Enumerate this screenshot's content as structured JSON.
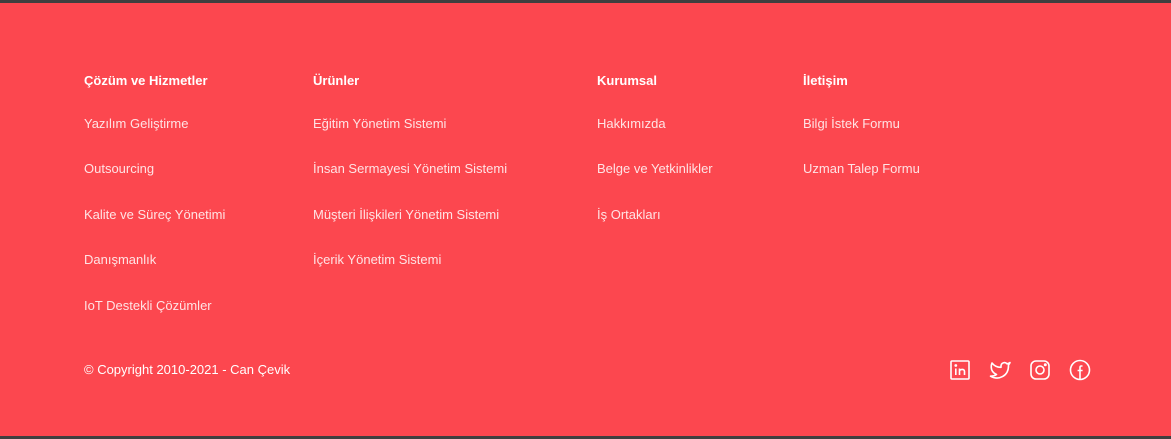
{
  "footer": {
    "columns": [
      {
        "title": "Çözüm ve Hizmetler",
        "items": [
          "Yazılım Geliştirme",
          "Outsourcing",
          "Kalite ve Süreç Yönetimi",
          "Danışmanlık",
          "IoT Destekli Çözümler"
        ]
      },
      {
        "title": "Ürünler",
        "items": [
          "Eğitim Yönetim Sistemi",
          "İnsan Sermayesi Yönetim Sistemi",
          "Müşteri İlişkileri Yönetim Sistemi",
          "İçerik Yönetim Sistemi"
        ]
      },
      {
        "title": "Kurumsal",
        "items": [
          "Hakkımızda",
          "Belge ve Yetkinlikler",
          "İş Ortakları"
        ]
      },
      {
        "title": "İletişim",
        "items": [
          "Bilgi İstek Formu",
          "Uzman Talep Formu"
        ]
      }
    ],
    "copyright": "© Copyright 2010-2021 - Can Çevik",
    "social": [
      {
        "icon": "linkedin-icon"
      },
      {
        "icon": "twitter-icon"
      },
      {
        "icon": "instagram-icon"
      },
      {
        "icon": "facebook-icon"
      }
    ],
    "colors": {
      "background": "#fc474f",
      "text": "#ffffff"
    }
  }
}
